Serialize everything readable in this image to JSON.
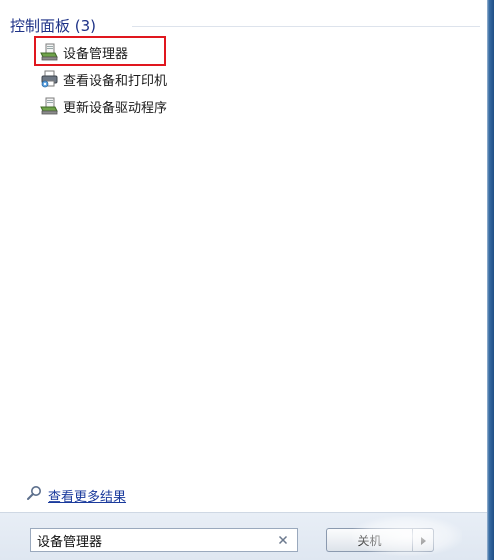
{
  "results": {
    "group_title": "控制面板 (3)",
    "items": [
      {
        "label": "设备管理器",
        "icon": "device-manager-icon"
      },
      {
        "label": "查看设备和打印机",
        "icon": "printer-icon"
      },
      {
        "label": "更新设备驱动程序",
        "icon": "device-driver-icon"
      }
    ],
    "highlighted_item": "设备管理器",
    "highlight_color": "#e0171e",
    "more_results_label": "查看更多结果",
    "more_results_icon": "search-icon"
  },
  "search": {
    "value": "设备管理器",
    "clear_icon": "close-icon"
  },
  "shutdown": {
    "label": "关机",
    "arrow_icon": "chevron-right-icon"
  },
  "colors": {
    "group_title": "#1e3287",
    "link": "#1a3a9c",
    "frame": "#1f4f86"
  }
}
